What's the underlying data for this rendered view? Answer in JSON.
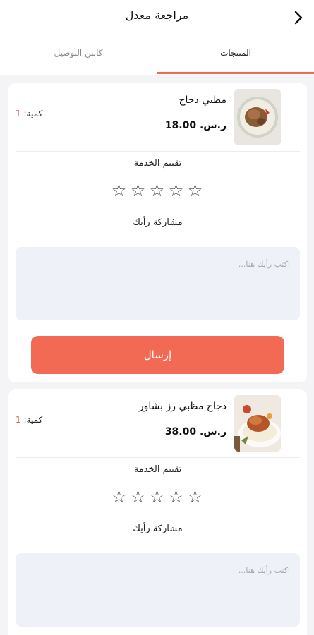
{
  "header": {
    "title": "مراجعة معدل"
  },
  "tabs": [
    {
      "label": "المنتجات",
      "active": true
    },
    {
      "label": "كابتن التوصيل",
      "active": false
    }
  ],
  "review_cards": [
    {
      "product_name": "مظبي دجاج",
      "price": "ر.س. 18.00",
      "qty_label": "كمية:",
      "qty_value": "1",
      "rating_label": "تقييم الخدمة",
      "rating": 0,
      "stars": [
        "☆",
        "☆",
        "☆",
        "☆",
        "☆"
      ],
      "share_label": "مشاركة رأيك",
      "comment_placeholder": "اكتب رأيك هنا...",
      "submit_label": "إرسال"
    },
    {
      "product_name": "دجاج مظبي رز بشاور",
      "price": "ر.س. 38.00",
      "qty_label": "كمية:",
      "qty_value": "1",
      "rating_label": "تقييم الخدمة",
      "rating": 0,
      "stars": [
        "☆",
        "☆",
        "☆",
        "☆",
        "☆"
      ],
      "share_label": "مشاركة رأيك",
      "comment_placeholder": "اكتب رأيك هنا..."
    }
  ],
  "colors": {
    "accent": "#f26a54",
    "quantity": "#e0523a",
    "input_bg": "#eef1f8"
  }
}
